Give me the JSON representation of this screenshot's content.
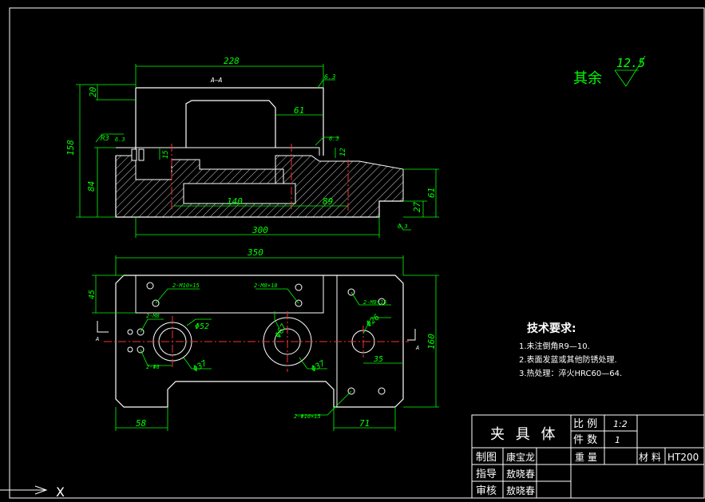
{
  "section_label": "A—A",
  "roughness": {
    "prefix": "其余",
    "value": "12.5"
  },
  "small_roughness": [
    "6.3",
    "6.3",
    "6.3",
    "6.3"
  ],
  "section_dims": {
    "width_top": "228",
    "height_total": "158",
    "height_top": "20",
    "height_body": "84",
    "pocket_width": "61",
    "height_15": "15",
    "height_12": "12",
    "hole_140": "140",
    "hole_89": "89",
    "base_300": "300",
    "right_61": "61",
    "right_27": "27",
    "chamfer": "R3"
  },
  "plan_dims": {
    "width_350": "350",
    "height_160": "160",
    "top_45": "45",
    "bottom_58": "58",
    "bottom_71": "71",
    "right_35": "35",
    "dia_52": "Φ52",
    "dia_37a": "Φ37",
    "dia_67": "Φ67",
    "dia_37b": "Φ37",
    "dia_26": "Φ26",
    "hole_a": "2-M10×15",
    "hole_b": "2-M8×10",
    "hole_c": "2-M8×15",
    "hole_d": "2-M8",
    "hole_e": "2-Φ8",
    "hole_f": "2-Φ10×15",
    "view_mark": "A"
  },
  "tech_req": {
    "title": "技术要求:",
    "items": [
      "1.未注倒角R9—10.",
      "2.表面发蓝或其他防锈处理.",
      "3.热处理：淬火HRC60—64."
    ]
  },
  "title_block": {
    "part_name": "夹 具 体",
    "scale_label": "比 例",
    "scale_value": "1:2",
    "qty_label": "件 数",
    "qty_value": "1",
    "weight_label": "重 量",
    "material_label": "材 料",
    "material_value": "HT200",
    "rows": [
      {
        "role": "制图",
        "name": "康宝龙"
      },
      {
        "role": "指导",
        "name": "敖晓春"
      },
      {
        "role": "审核",
        "name": "敖晓春"
      }
    ]
  },
  "ucs_label": "X",
  "colors": {
    "outline": "#ffffff",
    "dims": "#00ff00",
    "center": "#ff3030",
    "hatch": "#ffffff"
  }
}
